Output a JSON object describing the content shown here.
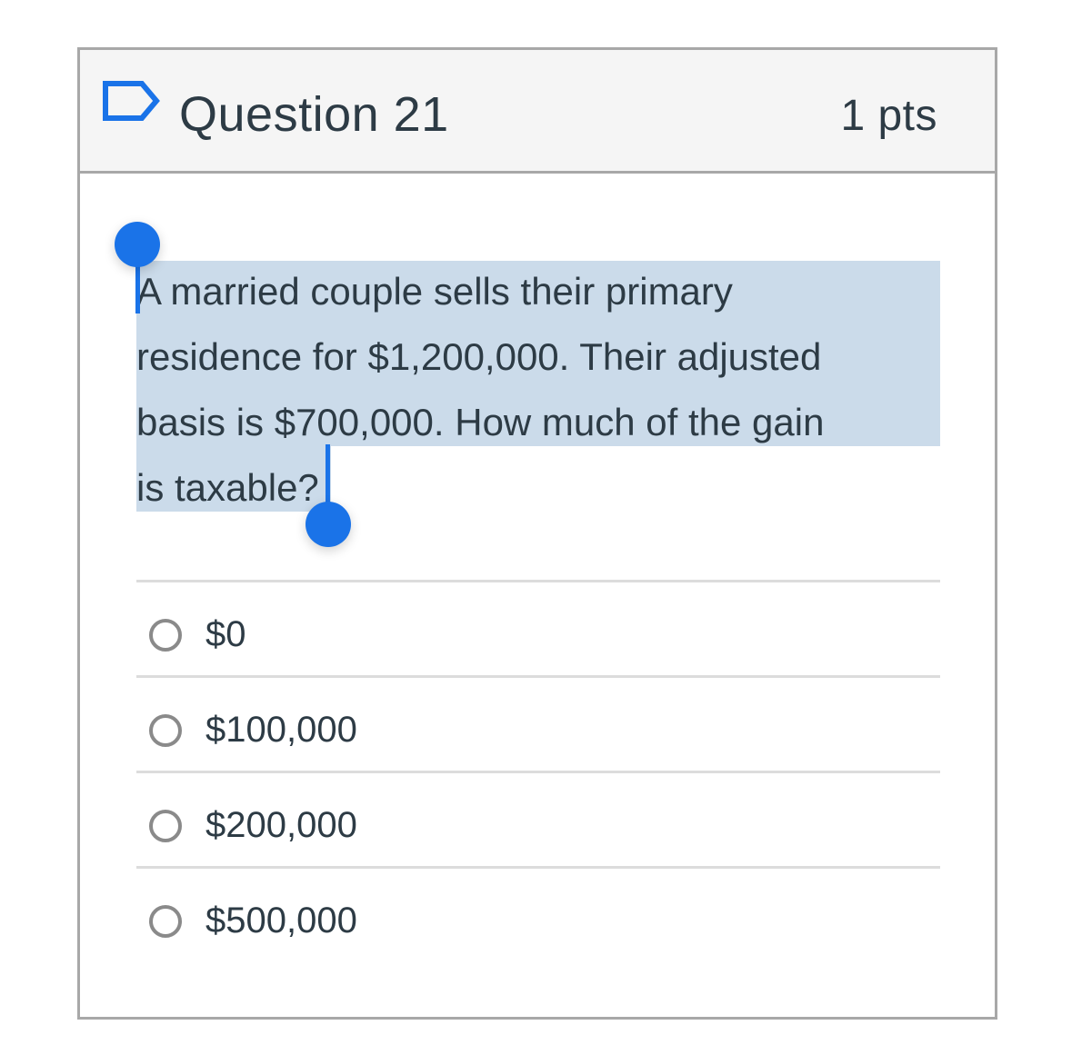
{
  "question": {
    "title": "Question 21",
    "points": "1 pts",
    "flag_icon": "flag-outline-icon",
    "text": "A married couple sells their primary residence for $1,200,000. Their adjusted basis is $700,000. How much of the gain is taxable?",
    "text_lines": [
      "A married couple sells their primary",
      "residence for $1,200,000. Their adjusted",
      "basis is $700,000. How much of the gain",
      "is taxable?"
    ]
  },
  "selection": {
    "highlight_color": "#cbdbea",
    "handle_color": "#1a73e8"
  },
  "answers": [
    {
      "label": "$0",
      "selected": false
    },
    {
      "label": "$100,000",
      "selected": false
    },
    {
      "label": "$200,000",
      "selected": false
    },
    {
      "label": "$500,000",
      "selected": false
    }
  ]
}
